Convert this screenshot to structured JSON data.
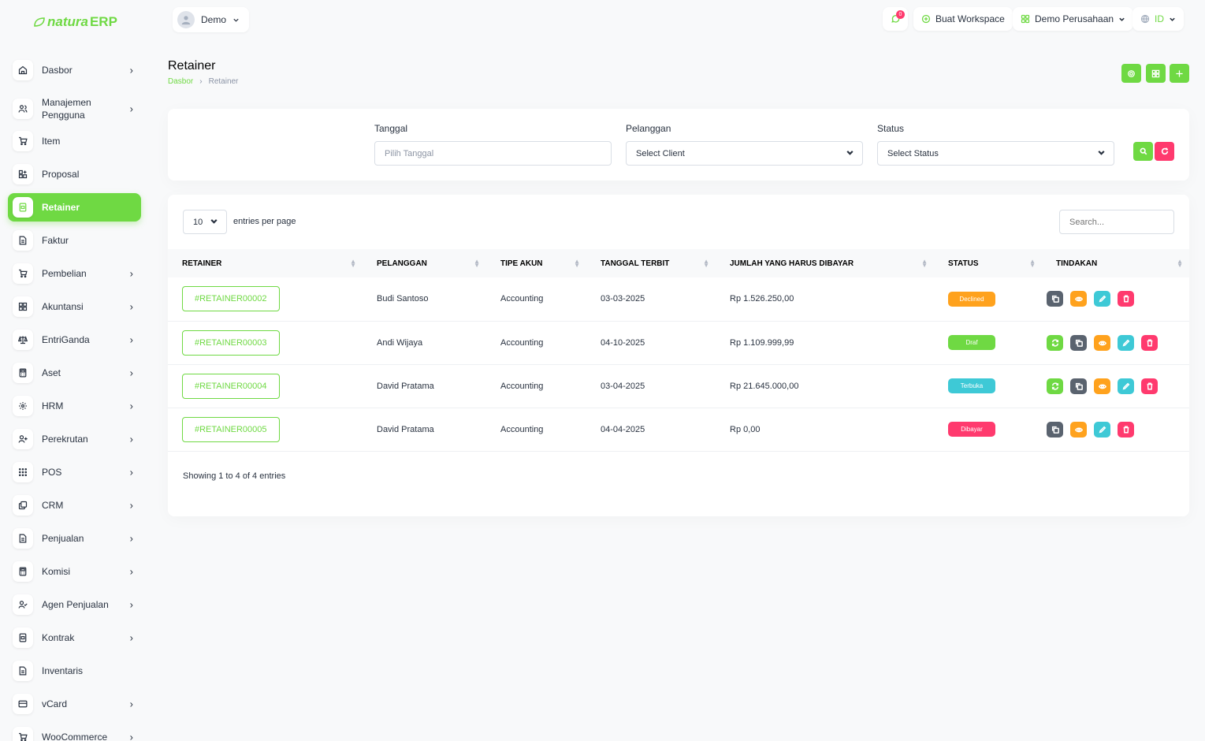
{
  "app": {
    "logo_prefix": "natura",
    "logo_suffix": "ERP"
  },
  "sidebar": {
    "items": [
      {
        "label": "Dasbor",
        "icon": "home-icon",
        "chevron": true
      },
      {
        "label": "Manajemen Pengguna",
        "icon": "users-icon",
        "chevron": true
      },
      {
        "label": "Item",
        "icon": "cart-icon",
        "chevron": false
      },
      {
        "label": "Proposal",
        "icon": "layout-icon",
        "chevron": false
      },
      {
        "label": "Retainer",
        "icon": "file-invoice-icon",
        "chevron": false,
        "active": true
      },
      {
        "label": "Faktur",
        "icon": "file-icon",
        "chevron": false
      },
      {
        "label": "Pembelian",
        "icon": "cart-icon",
        "chevron": true
      },
      {
        "label": "Akuntansi",
        "icon": "grid-icon",
        "chevron": true
      },
      {
        "label": "EntriGanda",
        "icon": "scale-icon",
        "chevron": true
      },
      {
        "label": "Aset",
        "icon": "calculator-icon",
        "chevron": true
      },
      {
        "label": "HRM",
        "icon": "hrm-icon",
        "chevron": true
      },
      {
        "label": "Perekrutan",
        "icon": "user-plus-icon",
        "chevron": true
      },
      {
        "label": "POS",
        "icon": "dots-grid-icon",
        "chevron": true
      },
      {
        "label": "CRM",
        "icon": "layers-icon",
        "chevron": true
      },
      {
        "label": "Penjualan",
        "icon": "file-icon",
        "chevron": true
      },
      {
        "label": "Komisi",
        "icon": "calculator-icon",
        "chevron": true
      },
      {
        "label": "Agen Penjualan",
        "icon": "user-check-icon",
        "chevron": true
      },
      {
        "label": "Kontrak",
        "icon": "file-invoice-icon",
        "chevron": true
      },
      {
        "label": "Inventaris",
        "icon": "file-icon",
        "chevron": false
      },
      {
        "label": "vCard",
        "icon": "card-icon",
        "chevron": true
      },
      {
        "label": "WooCommerce",
        "icon": "cart-icon",
        "chevron": true
      }
    ]
  },
  "header": {
    "user_name": "Demo",
    "notification_count": "0",
    "create_workspace": "Buat Workspace",
    "company": "Demo Perusahaan",
    "language": "ID"
  },
  "page": {
    "title": "Retainer",
    "breadcrumb_home": "Dasbor",
    "breadcrumb_current": "Retainer"
  },
  "filters": {
    "date_label": "Tanggal",
    "date_placeholder": "Pilih Tanggal",
    "client_label": "Pelanggan",
    "client_value": "Select Client",
    "status_label": "Status",
    "status_value": "Select Status"
  },
  "table": {
    "per_page": "10",
    "per_page_label": "entries per page",
    "search_placeholder": "Search...",
    "columns": [
      "RETAINER",
      "PELANGGAN",
      "TIPE AKUN",
      "TANGGAL TERBIT",
      "JUMLAH YANG HARUS DIBAYAR",
      "STATUS",
      "TINDAKAN"
    ],
    "rows": [
      {
        "id": "#RETAINER00002",
        "client": "Budi Santoso",
        "account": "Accounting",
        "date": "03-03-2025",
        "amount": "Rp 1.526.250,00",
        "status": "Declined",
        "status_color": "#ffa21d",
        "actions": [
          "copy",
          "view",
          "edit",
          "delete"
        ]
      },
      {
        "id": "#RETAINER00003",
        "client": "Andi Wijaya",
        "account": "Accounting",
        "date": "04-10-2025",
        "amount": "Rp 1.109.999,99",
        "status": "Draf",
        "status_color": "#6fd943",
        "actions": [
          "convert",
          "copy",
          "view",
          "edit",
          "delete"
        ]
      },
      {
        "id": "#RETAINER00004",
        "client": "David Pratama",
        "account": "Accounting",
        "date": "03-04-2025",
        "amount": "Rp 21.645.000,00",
        "status": "Terbuka",
        "status_color": "#3ec9d6",
        "actions": [
          "convert",
          "copy",
          "view",
          "edit",
          "delete"
        ]
      },
      {
        "id": "#RETAINER00005",
        "client": "David Pratama",
        "account": "Accounting",
        "date": "04-04-2025",
        "amount": "Rp 0,00",
        "status": "Dibayar",
        "status_color": "#ff3a6e",
        "actions": [
          "copy",
          "view",
          "edit",
          "delete"
        ]
      }
    ],
    "footer": "Showing 1 to 4 of 4 entries"
  },
  "colors": {
    "accent": "#6fd943",
    "danger": "#ff3a6e",
    "warning": "#ffa21d",
    "info": "#3ec9d6",
    "dark": "#5a636f"
  }
}
